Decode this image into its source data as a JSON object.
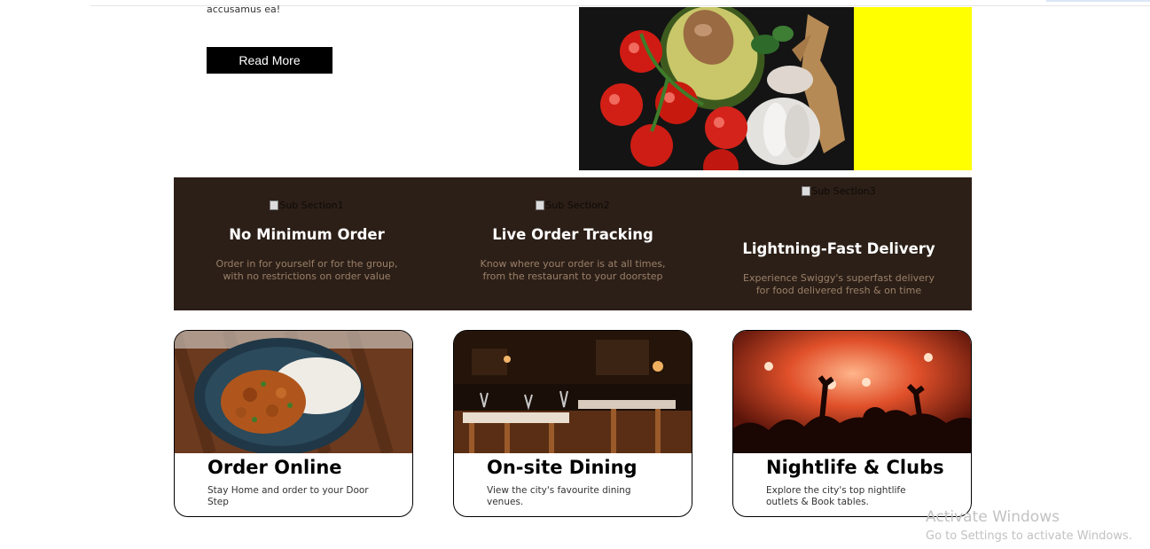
{
  "hero": {
    "tail_text": "accusamus ea!",
    "read_more_label": "Read More",
    "image_icon": "vegetables-photo",
    "accent_color": "#ffff00"
  },
  "features": {
    "background": "#2c1f17",
    "items": [
      {
        "img_alt": "Sub Section1",
        "title": "No Minimum Order",
        "desc_line1": "Order in for yourself or for the group,",
        "desc_line2": "with no restrictions on order value"
      },
      {
        "img_alt": "Sub Section2",
        "title": "Live Order Tracking",
        "desc_line1": "Know where your order is at all times,",
        "desc_line2": "from the restaurant to your doorstep"
      },
      {
        "img_alt": "Sub Section3",
        "title": "Lightning-Fast Delivery",
        "desc_line1": "Experience Swiggy's superfast delivery",
        "desc_line2": "for food delivered fresh & on time"
      }
    ]
  },
  "cards": [
    {
      "title": "Order Online",
      "desc": "Stay Home and order to your Door Step",
      "image_icon": "curry-plate-photo"
    },
    {
      "title": "On-site Dining",
      "desc": "View the city's favourite dining venues.",
      "image_icon": "restaurant-interior-photo"
    },
    {
      "title": "Nightlife & Clubs",
      "desc": "Explore the city's top nightlife outlets & Book tables.",
      "image_icon": "nightclub-crowd-photo"
    }
  ],
  "watermark": {
    "line1": "Activate Windows",
    "line2": "Go to Settings to activate Windows."
  }
}
